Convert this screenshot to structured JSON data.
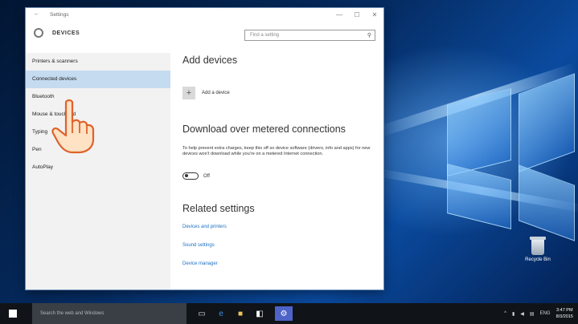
{
  "window": {
    "title": "Settings",
    "back_glyph": "←",
    "section": "DEVICES",
    "search_placeholder": "Find a setting",
    "controls": [
      "—",
      "☐",
      "✕"
    ]
  },
  "sidebar": {
    "items": [
      {
        "label": "Printers & scanners",
        "active": false
      },
      {
        "label": "Connected devices",
        "active": true
      },
      {
        "label": "Bluetooth",
        "active": false
      },
      {
        "label": "Mouse & touchpad",
        "active": false
      },
      {
        "label": "Typing",
        "active": false
      },
      {
        "label": "Pen",
        "active": false
      },
      {
        "label": "AutoPlay",
        "active": false
      }
    ]
  },
  "content": {
    "add_heading": "Add devices",
    "add_button_label": "Add a device",
    "add_button_icon": "plus-icon",
    "download_heading": "Download over metered connections",
    "description": "To help prevent extra charges, keep this off so device software (drivers, info and apps) for new devices won't download while you're on a metered Internet connection.",
    "toggle_state": "Off",
    "related_heading": "Related settings",
    "links": [
      "Devices and printers",
      "Sound settings",
      "Device manager"
    ]
  },
  "desktop": {
    "recycle_bin_label": "Recycle Bin",
    "accent_color": "#0a4a9e"
  },
  "taskbar": {
    "search_placeholder": "Search the web and Windows",
    "apps": [
      "task-view-icon",
      "edge-icon",
      "file-explorer-icon",
      "store-icon",
      "settings-app-icon"
    ],
    "tray": [
      "^",
      "ENG"
    ],
    "time": "3:47 PM",
    "date": "8/3/2015"
  }
}
